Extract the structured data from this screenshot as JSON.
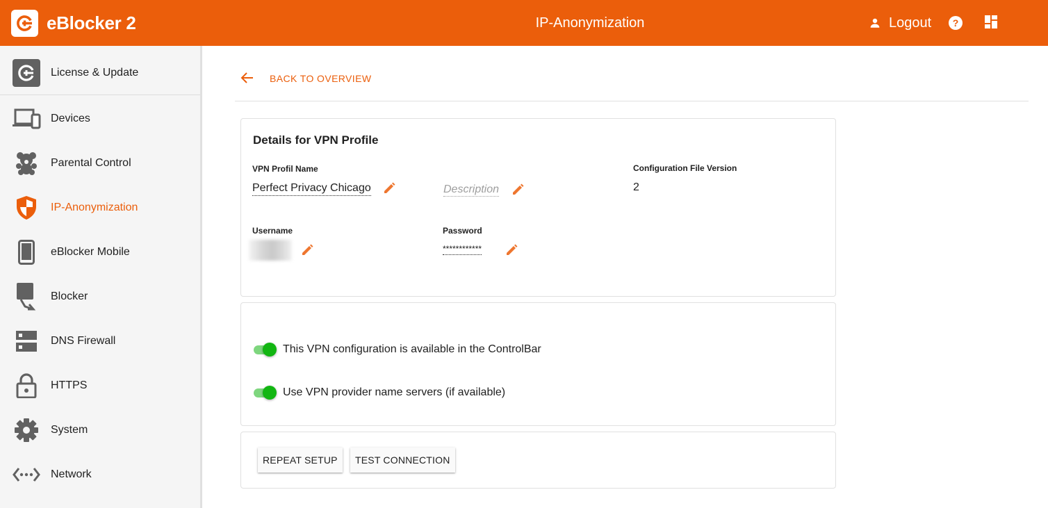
{
  "header": {
    "app_title": "eBlocker 2",
    "page_title": "IP-Anonymization",
    "logout_label": "Logout",
    "accent_color": "#eb5e0b"
  },
  "sidebar": {
    "items": [
      {
        "label": "License & Update",
        "icon": "refresh-logo-icon"
      },
      {
        "label": "Devices",
        "icon": "devices-icon"
      },
      {
        "label": "Parental Control",
        "icon": "teddy-bear-icon"
      },
      {
        "label": "IP-Anonymization",
        "icon": "shield-icon",
        "active": true
      },
      {
        "label": "eBlocker Mobile",
        "icon": "phone-icon"
      },
      {
        "label": "Blocker",
        "icon": "blocker-icon"
      },
      {
        "label": "DNS Firewall",
        "icon": "dns-icon"
      },
      {
        "label": "HTTPS",
        "icon": "lock-icon"
      },
      {
        "label": "System",
        "icon": "gear-icon"
      },
      {
        "label": "Network",
        "icon": "network-icon"
      }
    ]
  },
  "main": {
    "back_label": "BACK TO OVERVIEW",
    "details": {
      "title": "Details for VPN Profile",
      "profile_name_label": "VPN Profil Name",
      "profile_name": "Perfect Privacy Chicago",
      "description_placeholder": "Description",
      "config_version_label": "Configuration File Version",
      "config_version": "2",
      "username_label": "Username",
      "password_label": "Password",
      "password_mask": "************"
    },
    "options": [
      {
        "label": "This VPN configuration is available in the ControlBar",
        "enabled": true
      },
      {
        "label": "Use VPN provider name servers (if available)",
        "enabled": true
      }
    ],
    "actions": {
      "repeat_setup": "REPEAT SETUP",
      "test_connection": "TEST CONNECTION"
    }
  }
}
